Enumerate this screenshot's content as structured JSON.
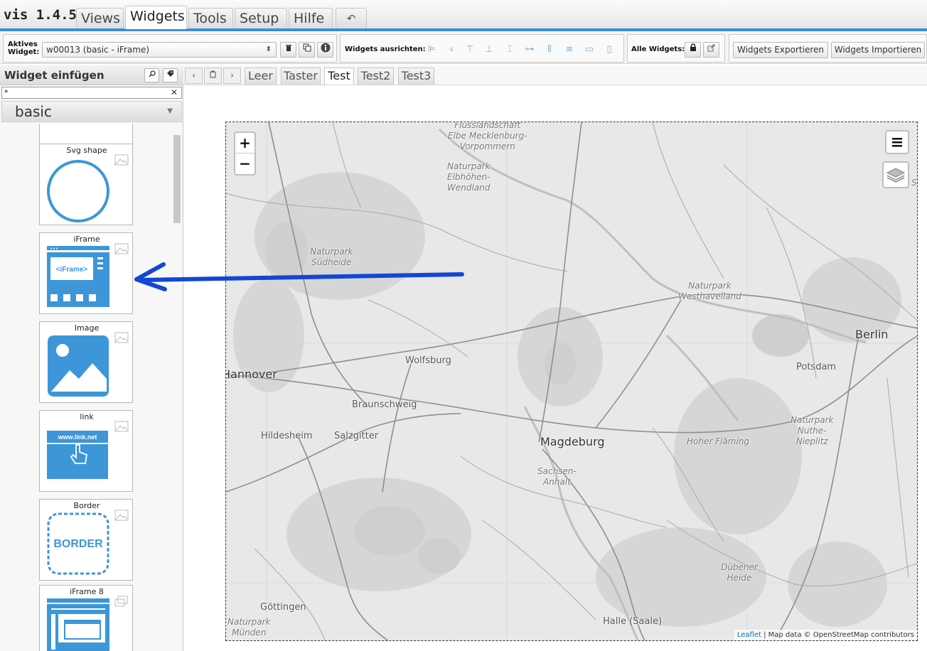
{
  "app": {
    "title": "vis 1.4.5"
  },
  "menu": {
    "tabs": [
      "Views",
      "Widgets",
      "Tools",
      "Setup",
      "Hilfe"
    ],
    "active": "Widgets",
    "undo_glyph": "↶"
  },
  "toolbar": {
    "active_widget_label": "Aktives Widget:",
    "active_widget_value": "w00013 (basic - iFrame)",
    "align_label": "Widgets ausrichten:",
    "all_widgets_label": "Alle Widgets:",
    "export_label": "Widgets Exportieren",
    "import_label": "Widgets Importieren"
  },
  "panel": {
    "title": "Widget einfügen",
    "filter_value": "*",
    "set_value": "basic",
    "widgets": [
      {
        "name": "Svg shape"
      },
      {
        "name": "iFrame"
      },
      {
        "name": "Image"
      },
      {
        "name": "link",
        "img_text": "www.link.net"
      },
      {
        "name": "Border",
        "img_text": "BORDER"
      },
      {
        "name": "iFrame 8"
      }
    ],
    "iframe_img_text": "<iFrame>"
  },
  "views": {
    "tabs": [
      "Leer",
      "Taster",
      "Test",
      "Test2",
      "Test3"
    ],
    "active": "Test"
  },
  "map": {
    "zoom_in": "+",
    "zoom_out": "−",
    "attribution_link": "Leaflet",
    "attribution_text": "| Map data © OpenStreetMap contributors",
    "labels": {
      "p1a": "Flusslandschaft",
      "p1b": "Elbe Mecklenburg-",
      "p1c": "Vorpommern",
      "p2a": "Naturpark",
      "p2b": "Elbhöhen-",
      "p2c": "Wendland",
      "p3a": "Naturpark",
      "p3b": "Südheide",
      "p4a": "Naturpark",
      "p4b": "Westhavelland",
      "berlin": "Berlin",
      "hannover": "Hannover",
      "wolfsburg": "Wolfsburg",
      "potsdam": "Potsdam",
      "braunschweig": "Braunschweig",
      "hildesheim": "Hildesheim",
      "salzgitter": "Salzgitter",
      "magdeburg": "Magdeburg",
      "hoher": "Hoher Fläming",
      "p5a": "Naturpark",
      "p5b": "Nuthe-",
      "p5c": "Nieplitz",
      "sachsen_a": "Sachsen-",
      "sachsen_b": "Anhalt",
      "duebener_a": "Dübener",
      "duebener_b": "Heide",
      "goettingen": "Göttingen",
      "p6a": "Naturpark",
      "p6b": "Münden",
      "halle": "Halle (Saale)",
      "edge_s": "S"
    }
  },
  "colors": {
    "accent": "#3b8ddb",
    "widget_blue": "#3d96d8",
    "arrow": "#1247d6"
  }
}
